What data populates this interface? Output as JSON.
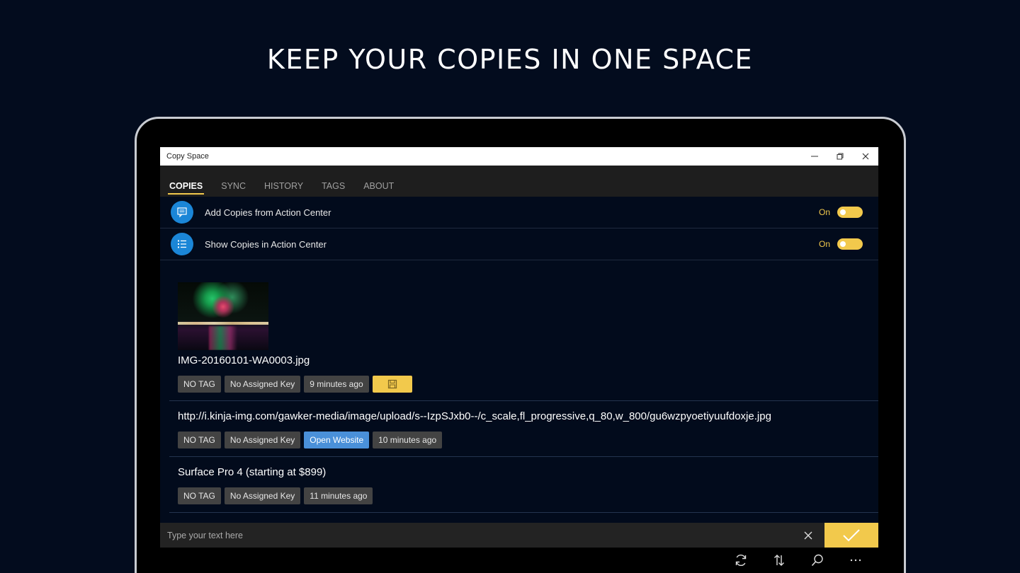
{
  "headline": "KEEP YOUR COPIES IN ONE SPACE",
  "window": {
    "title": "Copy Space"
  },
  "tabs": [
    {
      "label": "COPIES"
    },
    {
      "label": "SYNC"
    },
    {
      "label": "HISTORY"
    },
    {
      "label": "TAGS"
    },
    {
      "label": "ABOUT"
    }
  ],
  "settings": [
    {
      "label": "Add Copies from Action Center",
      "state": "On"
    },
    {
      "label": "Show Copies in Action Center",
      "state": "On"
    }
  ],
  "copies": [
    {
      "title": "IMG-20160101-WA0003.jpg",
      "tag": "NO TAG",
      "key": "No Assigned Key",
      "time": "9 minutes ago"
    },
    {
      "title": "http://i.kinja-img.com/gawker-media/image/upload/s--IzpSJxb0--/c_scale,fl_progressive,q_80,w_800/gu6wzpyoetiyuufdoxje.jpg",
      "tag": "NO TAG",
      "key": "No Assigned Key",
      "action": "Open Website",
      "time": "10 minutes ago"
    },
    {
      "title": "Surface Pro 4 (starting at $899)",
      "tag": "NO TAG",
      "key": "No Assigned Key",
      "time": "11 minutes ago"
    }
  ],
  "input": {
    "placeholder": "Type your text here",
    "value": ""
  },
  "colors": {
    "accent": "#f2c94c",
    "icon_blue": "#1b86d7",
    "link_chip": "#4a90d9",
    "background": "#030c1e"
  }
}
